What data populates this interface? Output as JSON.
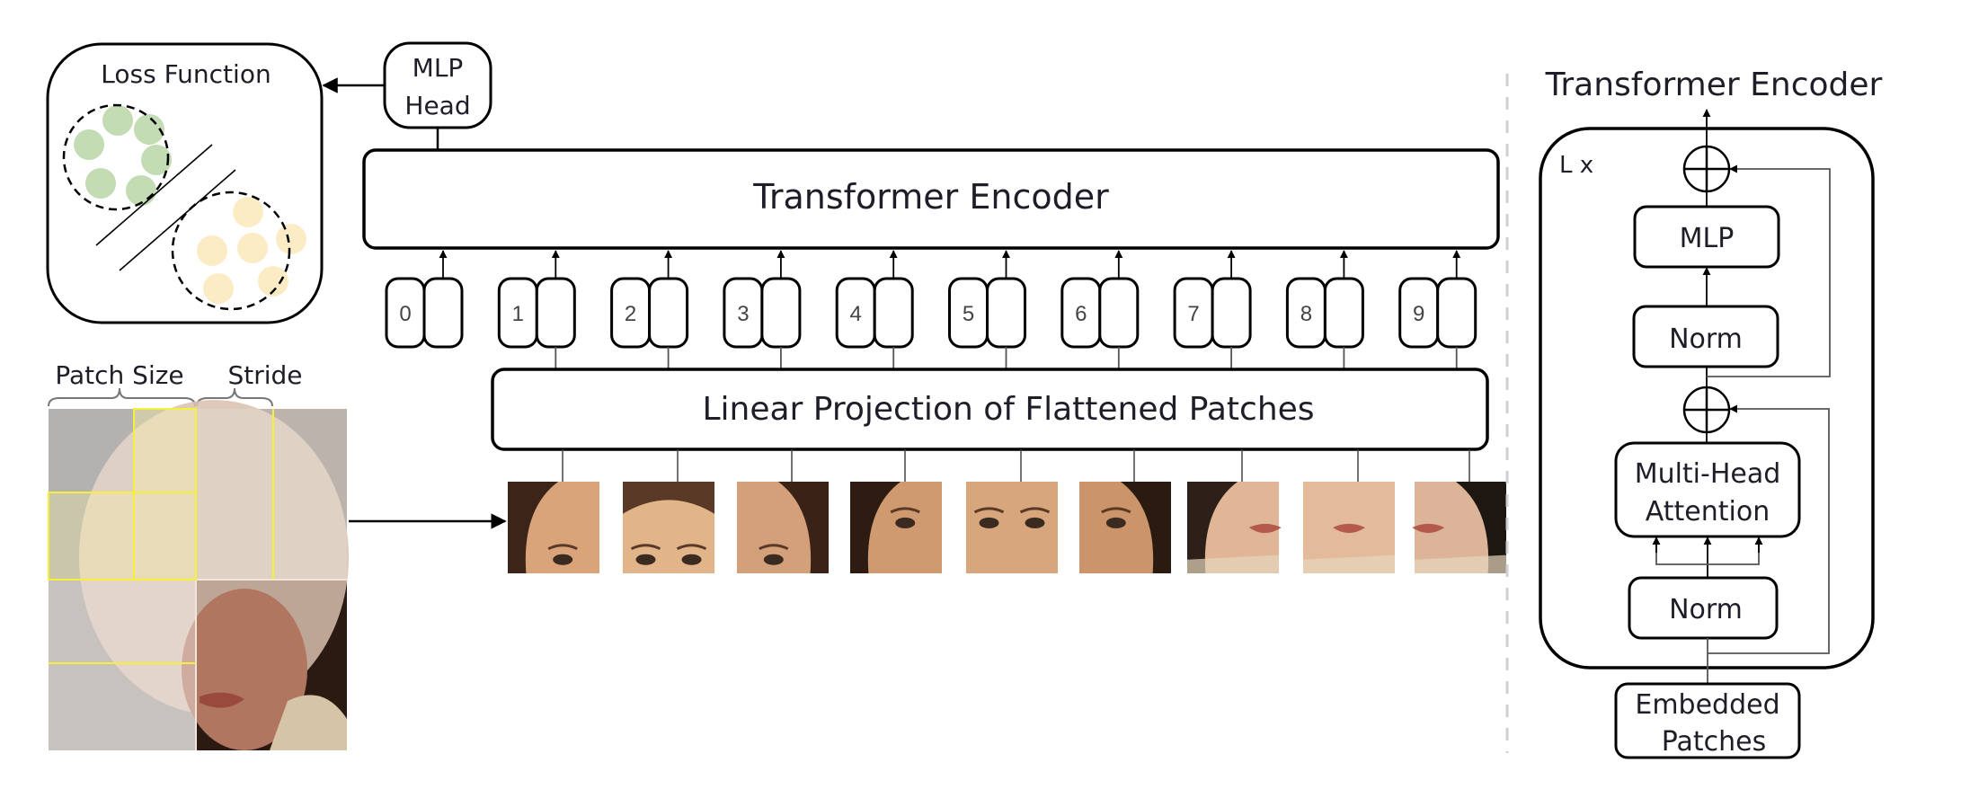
{
  "loss_panel": {
    "title": "Loss Function",
    "cluster_a_color": "#c3dcb4",
    "cluster_b_color": "#fcecc6"
  },
  "mlp_head": {
    "line1": "MLP",
    "line2": "Head"
  },
  "main_encoder": {
    "label": "Transformer Encoder"
  },
  "tokens": [
    {
      "index": "0",
      "has_patch": false
    },
    {
      "index": "1",
      "has_patch": true
    },
    {
      "index": "2",
      "has_patch": true
    },
    {
      "index": "3",
      "has_patch": true
    },
    {
      "index": "4",
      "has_patch": true
    },
    {
      "index": "5",
      "has_patch": true
    },
    {
      "index": "6",
      "has_patch": true
    },
    {
      "index": "7",
      "has_patch": true
    },
    {
      "index": "8",
      "has_patch": true
    },
    {
      "index": "9",
      "has_patch": true
    }
  ],
  "projection": {
    "label": "Linear Projection of Flattened Patches"
  },
  "patch_panel": {
    "patch_size_label": "Patch Size",
    "stride_label": "Stride",
    "highlight_color": "#f5f03a"
  },
  "patches": [
    {
      "name": "forehead-left",
      "skin": "#d9a47a",
      "hair": "#3b2418"
    },
    {
      "name": "forehead-center",
      "skin": "#e2b48a",
      "hair": "#5a3a26"
    },
    {
      "name": "forehead-right",
      "skin": "#d4a07a",
      "hair": "#3a2216"
    },
    {
      "name": "eye-left",
      "skin": "#cf9a70",
      "hair": "#2e1c12"
    },
    {
      "name": "eyes-center",
      "skin": "#d8a67c",
      "hair": "#7a5236"
    },
    {
      "name": "eye-right",
      "skin": "#cc946a",
      "hair": "#2a1a10"
    },
    {
      "name": "mouth-left",
      "skin": "#e0b696",
      "hair": "#2c2018"
    },
    {
      "name": "mouth-center",
      "skin": "#e4bb9a",
      "hair": "#8a6a52"
    },
    {
      "name": "mouth-right",
      "skin": "#dcb49a",
      "hair": "#1e1610"
    }
  ],
  "encoder_detail": {
    "title": "Transformer Encoder",
    "repeat_label": "L x",
    "blocks": {
      "mlp": "MLP",
      "norm_top": "Norm",
      "attention_line1": "Multi-Head",
      "attention_line2": "Attention",
      "norm_bottom": "Norm",
      "embedded_line1": "Embedded",
      "embedded_line2": "Patches"
    }
  }
}
